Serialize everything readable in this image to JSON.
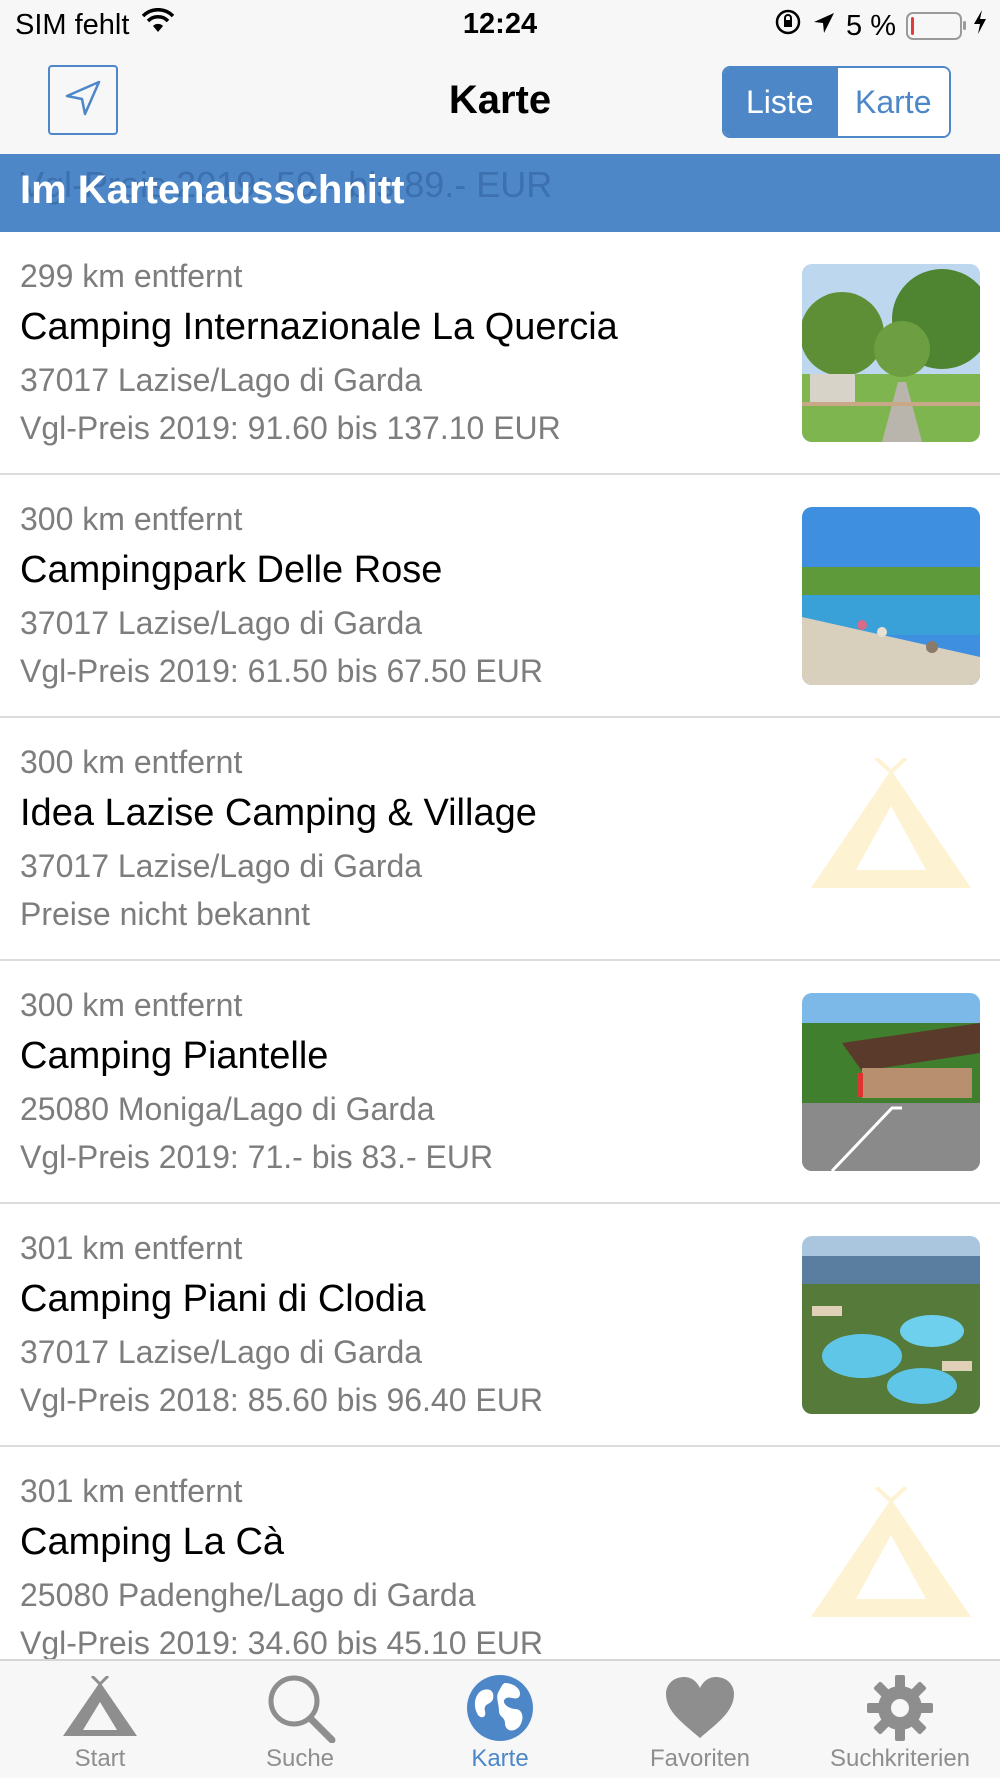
{
  "status_bar": {
    "carrier": "SIM fehlt",
    "time": "12:24",
    "battery_percent": "5 %",
    "battery_level": 0.05
  },
  "nav": {
    "title": "Karte",
    "segments": [
      {
        "label": "Liste",
        "selected": true
      },
      {
        "label": "Karte",
        "selected": false
      }
    ],
    "location_icon": "location-arrow-icon"
  },
  "section_header": {
    "label": "Im Kartenausschnitt",
    "ghost_text": "Vgl-Preis 2019: 59.- bis 89.- EUR"
  },
  "campsites": [
    {
      "distance": "299 km entfernt",
      "name": "Camping Internazionale La Quercia",
      "address": "37017 Lazise/Lago di Garda",
      "price": "Vgl-Preis 2019: 91.60 bis 137.10 EUR",
      "image": "photo-trees-path"
    },
    {
      "distance": "300 km entfernt",
      "name": "Campingpark Delle Rose",
      "address": "37017 Lazise/Lago di Garda",
      "price": "Vgl-Preis 2019: 61.50 bis 67.50 EUR",
      "image": "photo-beach-lake"
    },
    {
      "distance": "300 km entfernt",
      "name": "Idea Lazise Camping & Village",
      "address": "37017 Lazise/Lago di Garda",
      "price": "Preise nicht bekannt",
      "image": "tent-placeholder-icon"
    },
    {
      "distance": "300 km entfernt",
      "name": "Camping Piantelle",
      "address": "25080 Moniga/Lago di Garda",
      "price": "Vgl-Preis 2019: 71.- bis 83.- EUR",
      "image": "photo-entrance-road"
    },
    {
      "distance": "301 km entfernt",
      "name": "Camping Piani di Clodia",
      "address": "37017 Lazise/Lago di Garda",
      "price": "Vgl-Preis 2018: 85.60 bis 96.40 EUR",
      "image": "photo-pool-aerial"
    },
    {
      "distance": "301 km entfernt",
      "name": "Camping La Cà",
      "address": "25080 Padenghe/Lago di Garda",
      "price": "Vgl-Preis 2019: 34.60 bis 45.10 EUR",
      "image": "tent-placeholder-icon"
    }
  ],
  "tab_bar": {
    "tabs": [
      {
        "label": "Start",
        "icon": "tent-icon",
        "active": false
      },
      {
        "label": "Suche",
        "icon": "search-icon",
        "active": false
      },
      {
        "label": "Karte",
        "icon": "globe-icon",
        "active": true
      },
      {
        "label": "Favoriten",
        "icon": "heart-icon",
        "active": false
      },
      {
        "label": "Suchkriterien",
        "icon": "gear-icon",
        "active": false
      }
    ]
  },
  "colors": {
    "accent": "#4d87c8",
    "secondary_text": "#7d7d7d",
    "tab_inactive": "#8e8e8e",
    "tent_placeholder": "#fdf3d2"
  }
}
